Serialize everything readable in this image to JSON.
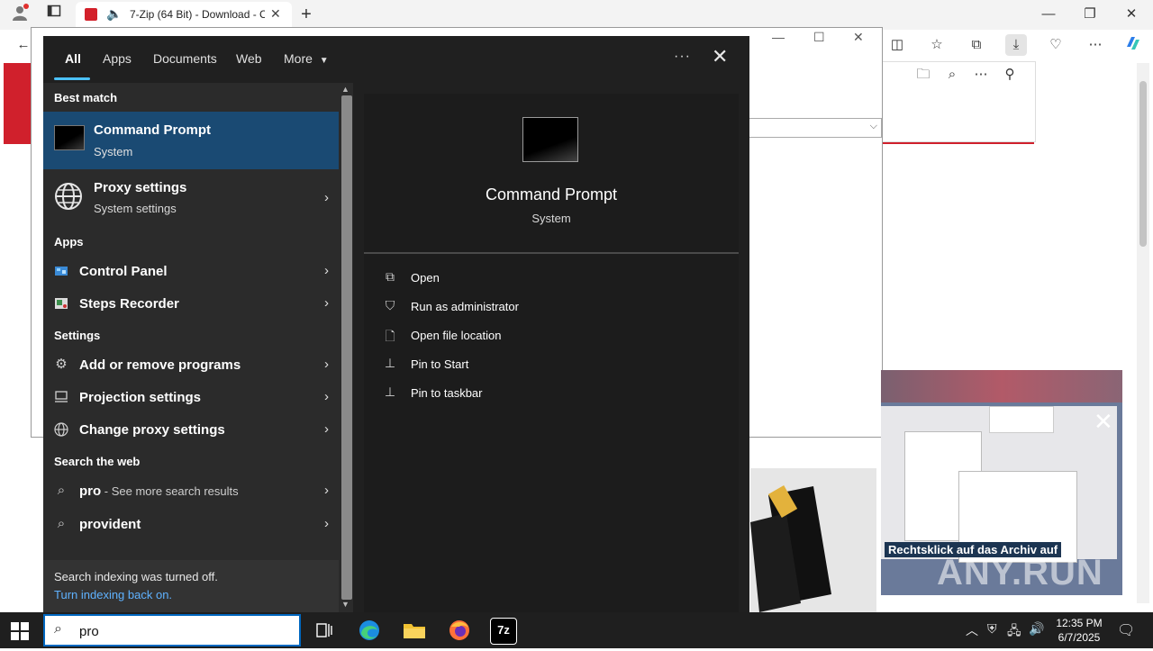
{
  "browser": {
    "tab_title": "7-Zip (64 Bit) - Download - C",
    "tab_close": "✕",
    "new_tab": "+"
  },
  "ad": {
    "caption": "Rechtsklick auf das Archiv auf",
    "watermark": "ANY.RUN"
  },
  "search_flyout": {
    "tabs": [
      "All",
      "Apps",
      "Documents",
      "Web",
      "More"
    ],
    "best_match_header": "Best match",
    "best_match": {
      "title": "Command Prompt",
      "subtitle": "System"
    },
    "proxy": {
      "title": "Proxy settings",
      "subtitle": "System settings"
    },
    "apps_header": "Apps",
    "apps": [
      {
        "label": "Control Panel",
        "icon": "control-panel-icon"
      },
      {
        "label": "Steps Recorder",
        "icon": "steps-recorder-icon"
      }
    ],
    "settings_header": "Settings",
    "settings": [
      {
        "label": "Add or remove programs",
        "icon": "gear-icon"
      },
      {
        "label": "Projection settings",
        "icon": "projection-icon"
      },
      {
        "label": "Change proxy settings",
        "icon": "globe-icon"
      }
    ],
    "web_header": "Search the web",
    "web": [
      {
        "label": "pro",
        "suffix": " - See more search results"
      },
      {
        "label": "provident",
        "suffix": ""
      }
    ],
    "indexing_note": "Search indexing was turned off.",
    "indexing_link": "Turn indexing back on.",
    "preview": {
      "title": "Command Prompt",
      "subtitle": "System",
      "actions": [
        {
          "label": "Open",
          "icon": "open-icon"
        },
        {
          "label": "Run as administrator",
          "icon": "shield-icon"
        },
        {
          "label": "Open file location",
          "icon": "file-location-icon"
        },
        {
          "label": "Pin to Start",
          "icon": "pin-icon"
        },
        {
          "label": "Pin to taskbar",
          "icon": "pin-icon"
        }
      ]
    }
  },
  "taskbar": {
    "search_text": "pro",
    "time": "12:35 PM",
    "date": "6/7/2025"
  }
}
